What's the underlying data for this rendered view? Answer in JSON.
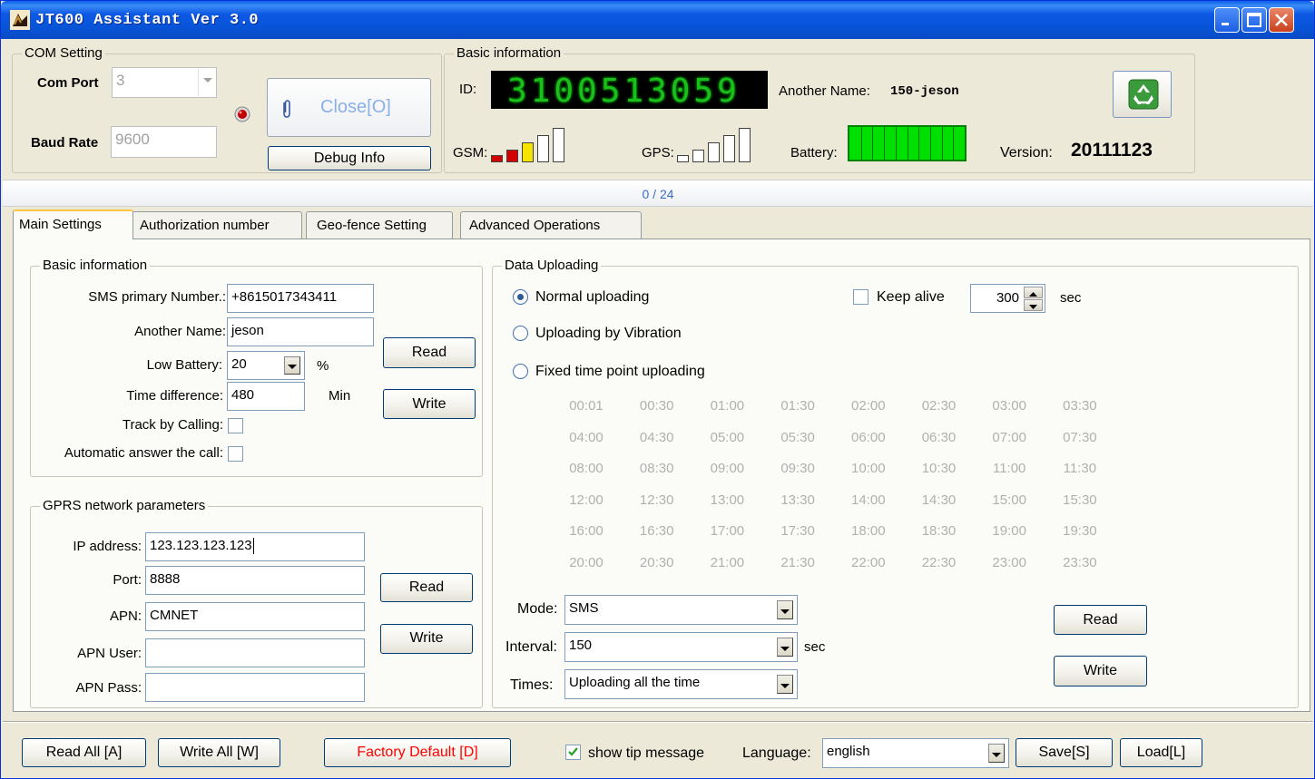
{
  "window": {
    "title": "JT600 Assistant Ver 3.0"
  },
  "com_setting": {
    "title": "COM Setting",
    "com_port_label": "Com Port",
    "com_port_value": "3",
    "baud_rate_label": "Baud Rate",
    "baud_rate_value": "9600",
    "close_button": "Close[O]",
    "debug_button": "Debug Info"
  },
  "basic_info_top": {
    "title": "Basic information",
    "id_label": "ID:",
    "id_value": "3100513059",
    "another_name_label": "Another Name:",
    "another_name_value": "150-jeson",
    "gsm_label": "GSM:",
    "gsm_level": 3,
    "gps_label": "GPS:",
    "gps_level": 0,
    "battery_label": "Battery:",
    "battery_level": 1.0,
    "version_label": "Version:",
    "version_value": "20111123"
  },
  "progress": {
    "text": "0 / 24"
  },
  "tabs": [
    {
      "label": "Main Settings",
      "active": true
    },
    {
      "label": "Authorization number",
      "active": false
    },
    {
      "label": "Geo-fence Setting",
      "active": false
    },
    {
      "label": "Advanced Operations",
      "active": false
    }
  ],
  "basic_info": {
    "title": "Basic information",
    "sms_label": "SMS primary Number.:",
    "sms_value": "+8615017343411",
    "another_name_label": "Another Name:",
    "another_name_value": "jeson",
    "low_battery_label": "Low Battery:",
    "low_battery_value": "20",
    "low_battery_unit": "%",
    "time_diff_label": "Time difference:",
    "time_diff_value": "480",
    "time_diff_unit": "Min",
    "track_label": "Track by Calling:",
    "auto_answer_label": "Automatic answer the call:",
    "read_button": "Read",
    "write_button": "Write"
  },
  "gprs": {
    "title": "GPRS network parameters",
    "ip_label": "IP address:",
    "ip_value": "123.123.123.123",
    "port_label": "Port:",
    "port_value": "8888",
    "apn_label": "APN:",
    "apn_value": "CMNET",
    "apn_user_label": "APN User:",
    "apn_user_value": "",
    "apn_pass_label": "APN Pass:",
    "apn_pass_value": "",
    "read_button": "Read",
    "write_button": "Write"
  },
  "data_uploading": {
    "title": "Data Uploading",
    "normal_label": "Normal uploading",
    "vibration_label": "Uploading by Vibration",
    "fixed_label": "Fixed time point uploading",
    "keep_alive_label": "Keep alive",
    "keep_alive_value": "300",
    "keep_alive_unit": "sec",
    "times": [
      "00:01",
      "00:30",
      "01:00",
      "01:30",
      "02:00",
      "02:30",
      "03:00",
      "03:30",
      "04:00",
      "04:30",
      "05:00",
      "05:30",
      "06:00",
      "06:30",
      "07:00",
      "07:30",
      "08:00",
      "08:30",
      "09:00",
      "09:30",
      "10:00",
      "10:30",
      "11:00",
      "11:30",
      "12:00",
      "12:30",
      "13:00",
      "13:30",
      "14:00",
      "14:30",
      "15:00",
      "15:30",
      "16:00",
      "16:30",
      "17:00",
      "17:30",
      "18:00",
      "18:30",
      "19:00",
      "19:30",
      "20:00",
      "20:30",
      "21:00",
      "21:30",
      "22:00",
      "22:30",
      "23:00",
      "23:30"
    ],
    "mode_label": "Mode:",
    "mode_value": "SMS",
    "interval_label": "Interval:",
    "interval_value": "150",
    "interval_unit": "sec",
    "times_label": "Times:",
    "times_value": "Uploading all the time",
    "read_button": "Read",
    "write_button": "Write"
  },
  "footer": {
    "read_all": "Read All [A]",
    "write_all": "Write All [W]",
    "factory_default": "Factory Default [D]",
    "show_tip": "show tip message",
    "language_label": "Language:",
    "language_value": "english",
    "save": "Save[S]",
    "load": "Load[L]"
  },
  "colors": {
    "title_bar": "#0754d8",
    "factory_default_text": "#ff0000",
    "led_green": "#1fd41f",
    "battery_green": "#00e000",
    "progress_text": "#3b6dc7"
  }
}
